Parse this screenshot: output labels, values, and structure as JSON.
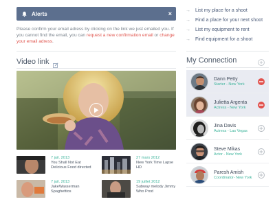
{
  "alert": {
    "title": "Alerts",
    "close_glyph": "×",
    "message_part1": "Please confirm your email adress by clicking on the link we just emailed you. If you cannot find the email, you can ",
    "resend_link": "request a new confirmation email",
    "message_part2": " or ",
    "change_link": "change your email adress",
    "message_part3": "."
  },
  "quick_links": [
    {
      "label": "List my place for a shoot",
      "icon": "arrow-right-icon"
    },
    {
      "label": "Find a place for your next shoot",
      "icon": "arrow-right-icon"
    },
    {
      "label": "List my equipment to rent",
      "icon": "arrow-right-icon"
    },
    {
      "label": "Find equipment for a shoot",
      "icon": "arrow-right-icon"
    }
  ],
  "video": {
    "heading": "Video link",
    "edit_icon": "edit-icon",
    "play_icon": "play-icon"
  },
  "thumbnails": [
    {
      "date": "7 juil. 2013",
      "title": "You Shall Not Eat Delicious Food directed"
    },
    {
      "date": "27 mars 2012",
      "title": "New York Time Lapse HD"
    },
    {
      "date": "7 juil. 2013",
      "title": "JakeWasserman Spaghettios"
    },
    {
      "date": "19 juillet 2012",
      "title": "Subway melody Jimmy Who Prod"
    }
  ],
  "connections": {
    "heading": "My Connection",
    "header_add_icon": "plus-circle-icon",
    "items": [
      {
        "name": "Dann Petty",
        "role": "Starter - New York",
        "action": "remove",
        "selected": true
      },
      {
        "name": "Julietta Argenta",
        "role": "Actress - New York",
        "action": "remove",
        "selected": true
      },
      {
        "name": "Jina Davis",
        "role": "Actress - Las Vegas",
        "action": "add",
        "selected": false
      },
      {
        "name": "Steve Mikas",
        "role": "Actor - New York",
        "action": "add",
        "selected": false
      },
      {
        "name": "Paresh Amish",
        "role": "Coordinator- New York",
        "action": "add",
        "selected": false
      }
    ]
  },
  "colors": {
    "alert_bg": "#5c6f8e",
    "link_red": "#e0564f",
    "accent_teal": "#3bb39a",
    "remove_red": "#e2524d",
    "selected_bg": "#e9ebf2"
  }
}
